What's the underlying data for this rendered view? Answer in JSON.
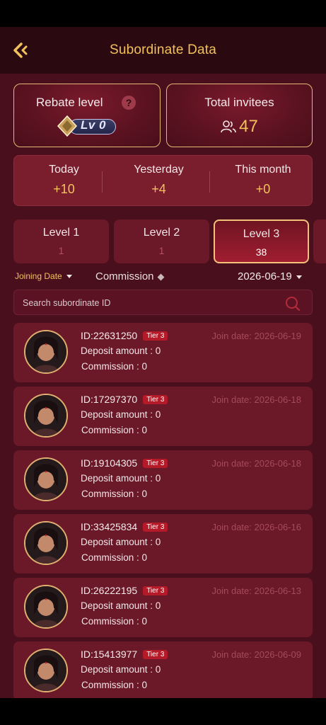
{
  "header": {
    "title": "Subordinate Data"
  },
  "rebate": {
    "label": "Rebate level",
    "help": "?",
    "level": "Lv 0"
  },
  "invitees": {
    "label": "Total invitees",
    "count": "47"
  },
  "periods": [
    {
      "label": "Today",
      "value": "+10"
    },
    {
      "label": "Yesterday",
      "value": "+4"
    },
    {
      "label": "This month",
      "value": "+0"
    }
  ],
  "levels": [
    {
      "label": "Level 1",
      "value": "1",
      "active": false
    },
    {
      "label": "Level 2",
      "value": "1",
      "active": false
    },
    {
      "label": "Level 3",
      "value": "38",
      "active": true
    }
  ],
  "filters": {
    "sort": "Joining Date",
    "commission": "Commission",
    "date": "2026-06-19"
  },
  "search": {
    "placeholder": "Search subordinate ID"
  },
  "members": [
    {
      "id": "ID:22631250",
      "tier": "Tier 3",
      "join": "Join date: 2026-06-19",
      "deposit": "Deposit amount : 0",
      "commission": "Commission : 0"
    },
    {
      "id": "ID:17297370",
      "tier": "Tier 3",
      "join": "Join date: 2026-06-18",
      "deposit": "Deposit amount : 0",
      "commission": "Commission : 0"
    },
    {
      "id": "ID:19104305",
      "tier": "Tier 3",
      "join": "Join date: 2026-06-18",
      "deposit": "Deposit amount : 0",
      "commission": "Commission : 0"
    },
    {
      "id": "ID:33425834",
      "tier": "Tier 3",
      "join": "Join date: 2026-06-16",
      "deposit": "Deposit amount : 0",
      "commission": "Commission : 0"
    },
    {
      "id": "ID:26222195",
      "tier": "Tier 3",
      "join": "Join date: 2026-06-13",
      "deposit": "Deposit amount : 0",
      "commission": "Commission : 0"
    },
    {
      "id": "ID:15413977",
      "tier": "Tier 3",
      "join": "Join date: 2026-06-09",
      "deposit": "Deposit amount : 0",
      "commission": "Commission : 0"
    }
  ],
  "colors": {
    "accent": "#f2c15c",
    "background": "#4a0f1c",
    "card": "#6b1828",
    "tier_badge": "#b51a28"
  }
}
